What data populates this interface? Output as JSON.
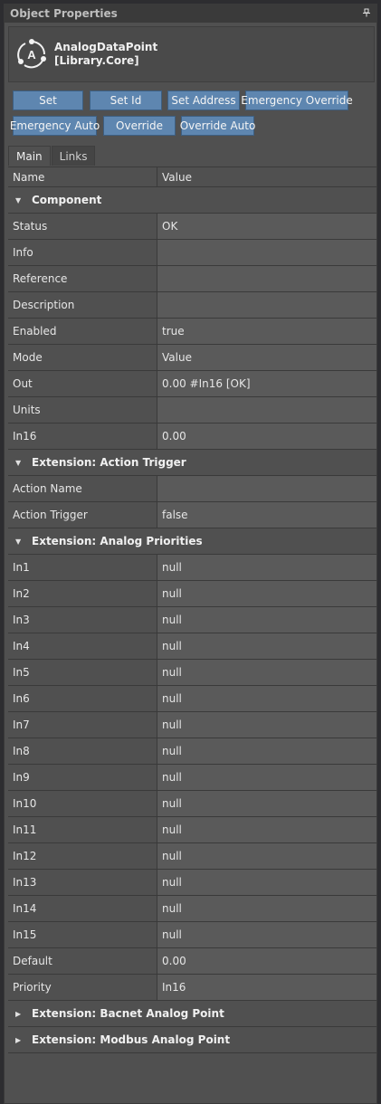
{
  "window": {
    "title": "Object Properties",
    "pin_icon": "pin-icon"
  },
  "object": {
    "name": "AnalogDataPoint",
    "library": "[Library.Core]",
    "icon": "analog-datapoint-icon"
  },
  "buttons": [
    {
      "id": "set",
      "label": "Set"
    },
    {
      "id": "set-id",
      "label": "Set Id"
    },
    {
      "id": "set-address",
      "label": "Set Address"
    },
    {
      "id": "emergency-override",
      "label": "Emergency Override"
    },
    {
      "id": "emergency-auto",
      "label": "Emergency Auto"
    },
    {
      "id": "override",
      "label": "Override"
    },
    {
      "id": "override-auto",
      "label": "Override Auto"
    }
  ],
  "tabs": [
    {
      "label": "Main",
      "active": true
    },
    {
      "label": "Links",
      "active": false
    }
  ],
  "grid": {
    "columns": {
      "name": "Name",
      "value": "Value"
    },
    "rows": [
      {
        "type": "category",
        "label": "Component",
        "expanded": true
      },
      {
        "type": "prop",
        "name": "Status",
        "value": "OK"
      },
      {
        "type": "prop",
        "name": "Info",
        "value": ""
      },
      {
        "type": "prop",
        "name": "Reference",
        "value": ""
      },
      {
        "type": "prop",
        "name": "Description",
        "value": ""
      },
      {
        "type": "prop",
        "name": "Enabled",
        "value": "true"
      },
      {
        "type": "prop",
        "name": "Mode",
        "value": "Value"
      },
      {
        "type": "prop",
        "name": "Out",
        "value": "0.00 #In16 [OK]"
      },
      {
        "type": "prop",
        "name": "Units",
        "value": ""
      },
      {
        "type": "prop",
        "name": "In16",
        "value": "0.00"
      },
      {
        "type": "category",
        "label": "Extension: Action Trigger",
        "expanded": true
      },
      {
        "type": "prop",
        "name": "Action Name",
        "value": ""
      },
      {
        "type": "prop",
        "name": "Action Trigger",
        "value": "false"
      },
      {
        "type": "category",
        "label": "Extension: Analog Priorities",
        "expanded": true
      },
      {
        "type": "prop",
        "name": "In1",
        "value": "null"
      },
      {
        "type": "prop",
        "name": "In2",
        "value": "null"
      },
      {
        "type": "prop",
        "name": "In3",
        "value": "null"
      },
      {
        "type": "prop",
        "name": "In4",
        "value": "null"
      },
      {
        "type": "prop",
        "name": "In5",
        "value": "null"
      },
      {
        "type": "prop",
        "name": "In6",
        "value": "null"
      },
      {
        "type": "prop",
        "name": "In7",
        "value": "null"
      },
      {
        "type": "prop",
        "name": "In8",
        "value": "null"
      },
      {
        "type": "prop",
        "name": "In9",
        "value": "null"
      },
      {
        "type": "prop",
        "name": "In10",
        "value": "null"
      },
      {
        "type": "prop",
        "name": "In11",
        "value": "null"
      },
      {
        "type": "prop",
        "name": "In12",
        "value": "null"
      },
      {
        "type": "prop",
        "name": "In13",
        "value": "null"
      },
      {
        "type": "prop",
        "name": "In14",
        "value": "null"
      },
      {
        "type": "prop",
        "name": "In15",
        "value": "null"
      },
      {
        "type": "prop",
        "name": "Default",
        "value": "0.00"
      },
      {
        "type": "prop",
        "name": "Priority",
        "value": "In16"
      },
      {
        "type": "category",
        "label": "Extension: Bacnet Analog Point",
        "expanded": false
      },
      {
        "type": "category",
        "label": "Extension: Modbus Analog Point",
        "expanded": false
      }
    ]
  },
  "colors": {
    "button": "#5e86b0",
    "panel": "#505050",
    "value_cell": "#5a5a5a",
    "header": "#3a3a3a"
  }
}
